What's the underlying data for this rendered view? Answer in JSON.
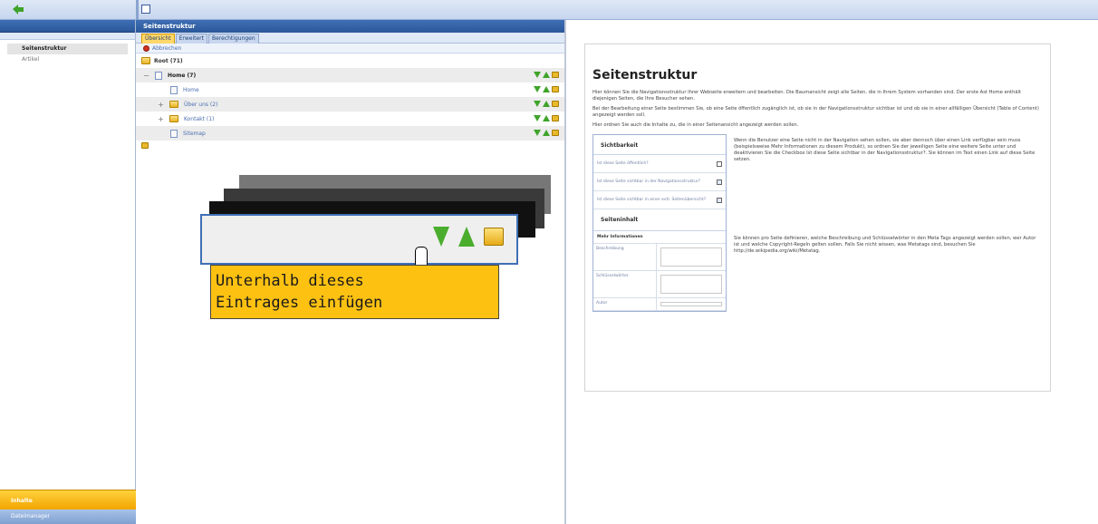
{
  "topbar": {},
  "sidebar": {
    "items": [
      {
        "label": "Seitenstruktur",
        "active": true
      },
      {
        "label": "Artikel",
        "active": false
      }
    ],
    "bottom": [
      {
        "label": "Inhalte"
      },
      {
        "label": "Dateimanager"
      }
    ]
  },
  "panel": {
    "title": "Seitenstruktur",
    "tabs": [
      "Übersicht",
      "Erweitert",
      "Berechtigungen"
    ],
    "toolbar": {
      "delete_label": "Abbrechen"
    },
    "tree": {
      "root": {
        "label": "Root (71)"
      },
      "rows": [
        {
          "label": "Home (7)",
          "bold": true
        },
        {
          "label": "Home"
        },
        {
          "label": "Über uns (2)"
        },
        {
          "label": "Kontakt (1)"
        },
        {
          "label": "Sitemap"
        }
      ]
    },
    "tooltip_text": "Unterhalb dieses\nEintrages einfügen"
  },
  "doc": {
    "title": "Seitenstruktur",
    "paragraphs": [
      "Hier können Sie die Navigationsstruktur Ihrer Webseite erweitern und bearbeiten. Die Baumansicht zeigt alle Seiten, die in Ihrem System vorhanden sind. Der erste Ast Home enthält diejenigen Seiten, die Ihre Besucher sehen.",
      "Bei der Bearbeitung einer Seite bestimmen Sie, ob eine Seite öffentlich zugänglich ist, ob sie in der Navigationsstruktur sichtbar ist und ob sie in einer allfälligen Übersicht (Table of Content) angezeigt werden soll.",
      "Hier ordnen Sie auch die Inhalte zu, die in einer Seitenansicht angezeigt werden sollen."
    ],
    "form": {
      "section1": "Sichtbarkeit",
      "rows": [
        {
          "label": "Ist diese Seite öffentlich?"
        },
        {
          "label": "Ist diese Seite sichtbar in der Navigationsstruktur?"
        },
        {
          "label": "Ist diese Seite sichtbar in einer evtl. Seitenübersicht?"
        }
      ],
      "section2": "Seiteninhalt",
      "meta_title": "Mehr Informationen",
      "meta_rows": [
        {
          "label": "Beschreibung"
        },
        {
          "label": "Schlüsselwörter"
        },
        {
          "label": "Autor"
        }
      ]
    },
    "desc1": "Wenn die Benutzer eine Seite nicht in der Navigation sehen sollen, sie aber dennoch über einen Link verfügbar sein muss (beispielsweise Mehr Informationen zu diesem Produkt), so ordnen Sie der jeweiligen Seite eine weitere Seite unter und deaktivieren Sie die Checkbox Ist diese Seite sichtbar in der Navigationsstruktur?. Sie können im Text einen Link auf diese Seite setzen.",
    "desc2": "Sie können pro Seite definieren, welche Beschreibung und Schlüsselwörter in den Meta Tags angezeigt werden sollen, wer Autor ist und welche Copyright-Regeln gelten sollen. Falls Sie nicht wissen, was Metatags sind, besuchen Sie http://de.wikipedia.org/wiki/Metatag."
  }
}
